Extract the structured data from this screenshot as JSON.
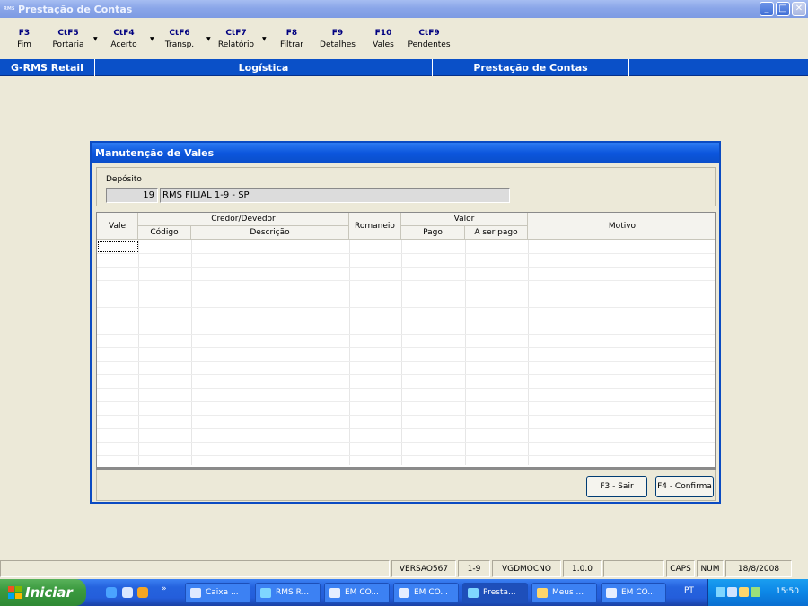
{
  "window": {
    "title": "Prestação de Contas",
    "app_icon_text": "RMS"
  },
  "toolbar": [
    {
      "key": "F3",
      "label": "Fim"
    },
    {
      "key": "CtF5",
      "label": "Portaria"
    },
    {
      "key": "CtF4",
      "label": "Acerto"
    },
    {
      "key": "CtF6",
      "label": "Transp."
    },
    {
      "key": "CtF7",
      "label": "Relatório"
    },
    {
      "key": "F8",
      "label": "Filtrar"
    },
    {
      "key": "F9",
      "label": "Detalhes"
    },
    {
      "key": "F10",
      "label": "Vales"
    },
    {
      "key": "CtF9",
      "label": "Pendentes"
    }
  ],
  "header": {
    "system": "G-RMS Retail",
    "module": "Logística",
    "screen": "Prestação de Contas"
  },
  "dialog": {
    "title": "Manutenção de Vales",
    "deposito_label": "Depósito",
    "deposito_code": "19",
    "deposito_name": "RMS FILIAL 1-9 - SP",
    "grid": {
      "vale": "Vale",
      "credor_devedor": "Credor/Devedor",
      "codigo": "Código",
      "descricao": "Descrição",
      "romaneio": "Romaneio",
      "valor": "Valor",
      "pago": "Pago",
      "a_ser_pago": "A ser pago",
      "motivo": "Motivo"
    },
    "buttons": {
      "sair": "F3 - Sair",
      "confirma": "F4 - Confirma"
    }
  },
  "statusbar": {
    "version": "VERSAO567",
    "filial": "1-9",
    "program": "VGDMOCNO",
    "build": "1.0.0",
    "caps": "CAPS",
    "num": "NUM",
    "date": "18/8/2008"
  },
  "taskbar": {
    "start": "Iniciar",
    "tasks": [
      "Caixa ...",
      "RMS R...",
      "EM CO...",
      "EM CO...",
      "Presta...",
      "Meus ...",
      "EM CO..."
    ],
    "language": "PT",
    "clock": "15:50"
  },
  "colors": {
    "accent": "#0a50c8",
    "dialog_border": "#0b4bc2",
    "taskbar": "#245edb",
    "start": "#3b9a3f"
  }
}
